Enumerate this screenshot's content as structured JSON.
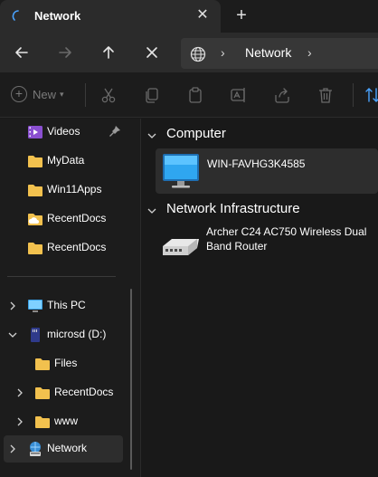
{
  "tab": {
    "title": "Network",
    "close_symbol": "✕",
    "new_tab_symbol": "+"
  },
  "nav": {
    "back": "arrow-left-icon",
    "forward": "arrow-right-icon",
    "up": "arrow-up-icon",
    "stop": "close-icon"
  },
  "address": {
    "separator": "›",
    "location": "Network"
  },
  "commands": {
    "new_label": "New",
    "new_plus": "+",
    "new_chevron": "▾"
  },
  "sidebar": {
    "items": [
      {
        "label": "Videos",
        "icon": "video-folder-icon",
        "pinned": true
      },
      {
        "label": "MyData",
        "icon": "folder-icon"
      },
      {
        "label": "Win11Apps",
        "icon": "folder-icon"
      },
      {
        "label": "RecentDocs",
        "icon": "cloud-folder-icon"
      },
      {
        "label": "RecentDocs",
        "icon": "folder-icon"
      },
      {
        "label": "This PC",
        "icon": "pc-icon"
      },
      {
        "label": "microsd (D:)",
        "icon": "sd-card-icon"
      },
      {
        "label": "Files",
        "icon": "folder-icon"
      },
      {
        "label": "RecentDocs",
        "icon": "folder-icon"
      },
      {
        "label": "www",
        "icon": "folder-icon"
      },
      {
        "label": "Network",
        "icon": "network-icon",
        "selected": true
      }
    ]
  },
  "groups": [
    {
      "title": "Computer",
      "items": [
        {
          "label": "WIN-FAVHG3K4585",
          "icon": "monitor-icon"
        }
      ]
    },
    {
      "title": "Network Infrastructure",
      "items": [
        {
          "label": "Archer C24 AC750 Wireless Dual Band Router",
          "icon": "router-icon"
        }
      ]
    }
  ],
  "colors": {
    "accent": "#4aa3ff",
    "folder": "#f2c14e",
    "selection": "#2d2d2d"
  }
}
